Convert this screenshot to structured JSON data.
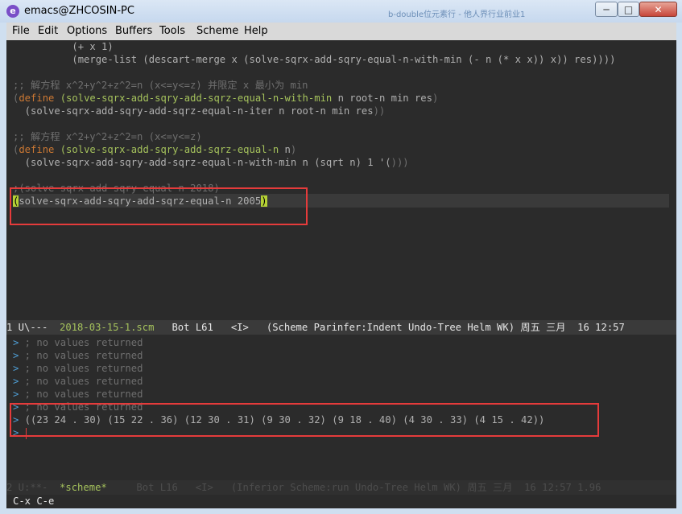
{
  "window": {
    "title": "emacs@ZHCOSIN-PC",
    "subtitle": "b-double位元素行 - 他人界行业前业1",
    "icon": "emacs-icon",
    "buttons": {
      "minimize": "─",
      "maximize": "□",
      "close": "✕"
    }
  },
  "menu": [
    "File",
    "Edit",
    "Options",
    "Buffers",
    "Tools",
    "Scheme",
    "Help"
  ],
  "editor": {
    "lines": [
      {
        "segments": [
          [
            "pl",
            "          (+ x 1)"
          ]
        ]
      },
      {
        "segments": [
          [
            "pl",
            "          (merge-list (descart-merge x (solve-sqrx-add-sqry-equal-n-with-min (- n (* x x)) x)) res))))"
          ]
        ]
      },
      {
        "segments": []
      },
      {
        "segments": [
          [
            "cm",
            ";; 解方程 x^2+y^2+z^2=n (x<=y<=z) 并限定 x 最小为 min"
          ]
        ]
      },
      {
        "segments": [
          [
            "pr",
            "("
          ],
          [
            "kw",
            "define"
          ],
          [
            "pl",
            " "
          ],
          [
            "fn",
            "(solve-sqrx-add-sqry-add-sqrz-equal-n-with-min"
          ],
          [
            "pl",
            " n root-n min res"
          ],
          [
            "pr",
            ")"
          ]
        ]
      },
      {
        "segments": [
          [
            "pl",
            "  (solve-sqrx-add-sqry-add-sqrz-equal-n-iter n root-n min res"
          ],
          [
            "pr",
            "))"
          ]
        ]
      },
      {
        "segments": []
      },
      {
        "segments": [
          [
            "cm",
            ";; 解方程 x^2+y^2+z^2=n (x<=y<=z)"
          ]
        ]
      },
      {
        "segments": [
          [
            "pr",
            "("
          ],
          [
            "kw",
            "define"
          ],
          [
            "pl",
            " "
          ],
          [
            "fn",
            "(solve-sqrx-add-sqry-add-sqrz-equal-n"
          ],
          [
            "pl",
            " n"
          ],
          [
            "pr",
            ")"
          ]
        ]
      },
      {
        "segments": [
          [
            "pl",
            "  (solve-sqrx-add-sqry-add-sqrz-equal-n-with-min n (sqrt n) 1 '("
          ],
          [
            "pr",
            ")))"
          ]
        ]
      },
      {
        "segments": []
      },
      {
        "segments": [
          [
            "cm",
            ";(solve-sqrx-add-sqry-equal-n 2018)"
          ]
        ]
      },
      {
        "segments": [
          [
            "cursor",
            "("
          ],
          [
            "pl",
            "solve-sqrx-add-sqry-add-sqrz-equal-n 2005"
          ],
          [
            "cursor",
            ")"
          ]
        ]
      }
    ]
  },
  "modeline_top": {
    "prefix": "1 U\\---  ",
    "filename": "2018-03-15-1.scm",
    "rest": "   Bot L61   <I>   (Scheme Parinfer:Indent Undo-Tree Helm WK) 周五 三月  16 12:57"
  },
  "repl": {
    "prompt": ">",
    "lines": [
      {
        "prompt": ">",
        "text": " ; no values returned",
        "style": "cm"
      },
      {
        "prompt": ">",
        "text": " ; no values returned",
        "style": "cm"
      },
      {
        "prompt": ">",
        "text": " ; no values returned",
        "style": "cm"
      },
      {
        "prompt": ">",
        "text": " ; no values returned",
        "style": "cm"
      },
      {
        "prompt": ">",
        "text": " ; no values returned",
        "style": "cm"
      },
      {
        "prompt": ">",
        "text": " ; no values returned",
        "style": "cm"
      },
      {
        "prompt": ">",
        "text": " ((23 24 . 30) (15 22 . 36) (12 30 . 31) (9 30 . 32) (9 18 . 40) (4 30 . 33) (4 15 . 42))",
        "style": "pl"
      },
      {
        "prompt": ">",
        "text": "",
        "style": "pl"
      }
    ]
  },
  "modeline_bottom": {
    "prefix": "2 U:**-  ",
    "buffer": "*scheme*",
    "rest": "     Bot L16   <I>   (Inferior Scheme:run Undo-Tree Helm WK) 周五 三月  16 12:57 1.96"
  },
  "echo_area": "C-x C-e",
  "colors": {
    "annotation_box": "#e53b3b",
    "keyword": "#cc7833",
    "function_name": "#a5c25c",
    "paren_match": "#b5d135"
  }
}
